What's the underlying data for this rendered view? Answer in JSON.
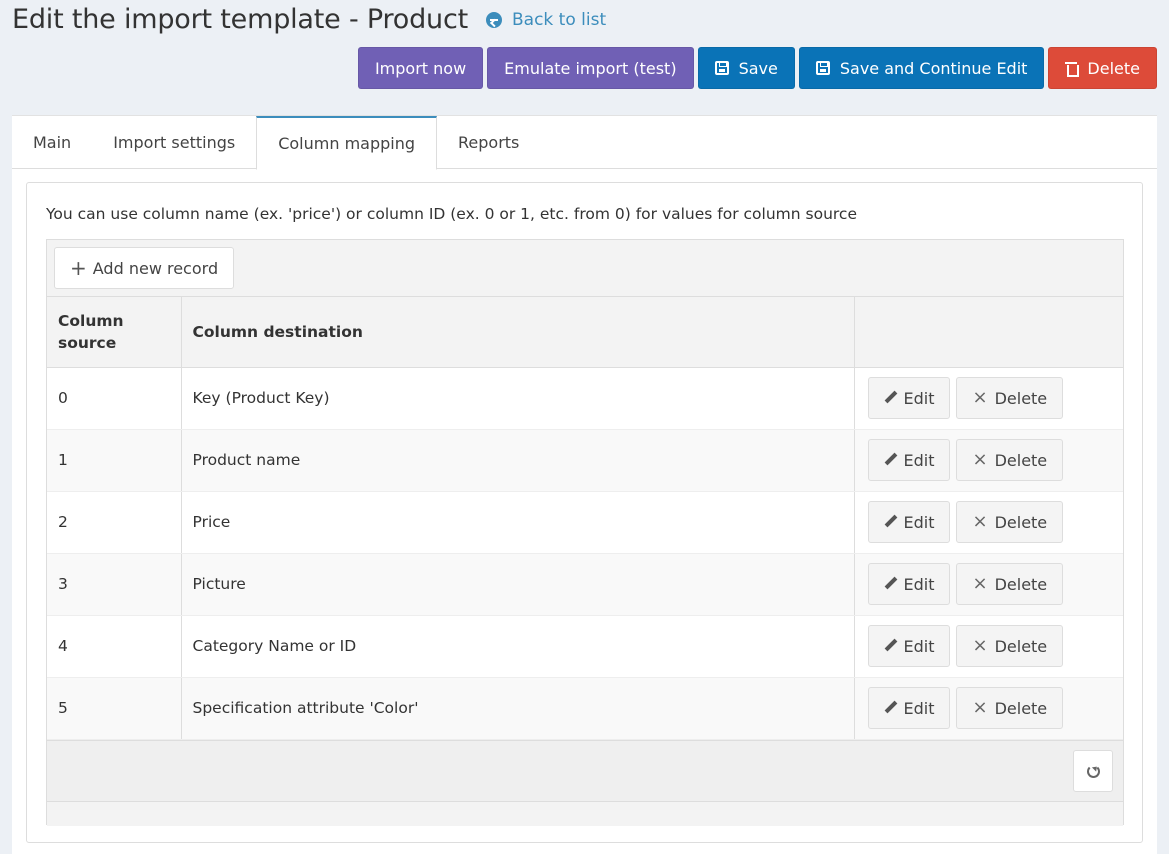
{
  "header": {
    "title": "Edit the import template - Product",
    "back_label": "Back to list"
  },
  "actions": {
    "import_now": "Import now",
    "emulate": "Emulate import (test)",
    "save": "Save",
    "save_continue": "Save and Continue Edit",
    "delete": "Delete"
  },
  "tabs": [
    {
      "label": "Main"
    },
    {
      "label": "Import settings"
    },
    {
      "label": "Column mapping",
      "active": true
    },
    {
      "label": "Reports"
    }
  ],
  "help_text": "You can use column name (ex. 'price') or column ID (ex. 0 or 1, etc. from 0) for values for column source",
  "grid": {
    "add_label": "Add new record",
    "headers": {
      "source": "Column source",
      "destination": "Column destination"
    },
    "edit_label": "Edit",
    "delete_label": "Delete",
    "rows": [
      {
        "source": "0",
        "destination": "Key (Product Key)"
      },
      {
        "source": "1",
        "destination": "Product name"
      },
      {
        "source": "2",
        "destination": "Price"
      },
      {
        "source": "3",
        "destination": "Picture"
      },
      {
        "source": "4",
        "destination": "Category Name or ID"
      },
      {
        "source": "5",
        "destination": "Specification attribute 'Color'"
      }
    ]
  },
  "colors": {
    "purple": "#7060b5",
    "blue": "#0a73b7",
    "red": "#dd4b39",
    "link": "#3c8dbc"
  }
}
